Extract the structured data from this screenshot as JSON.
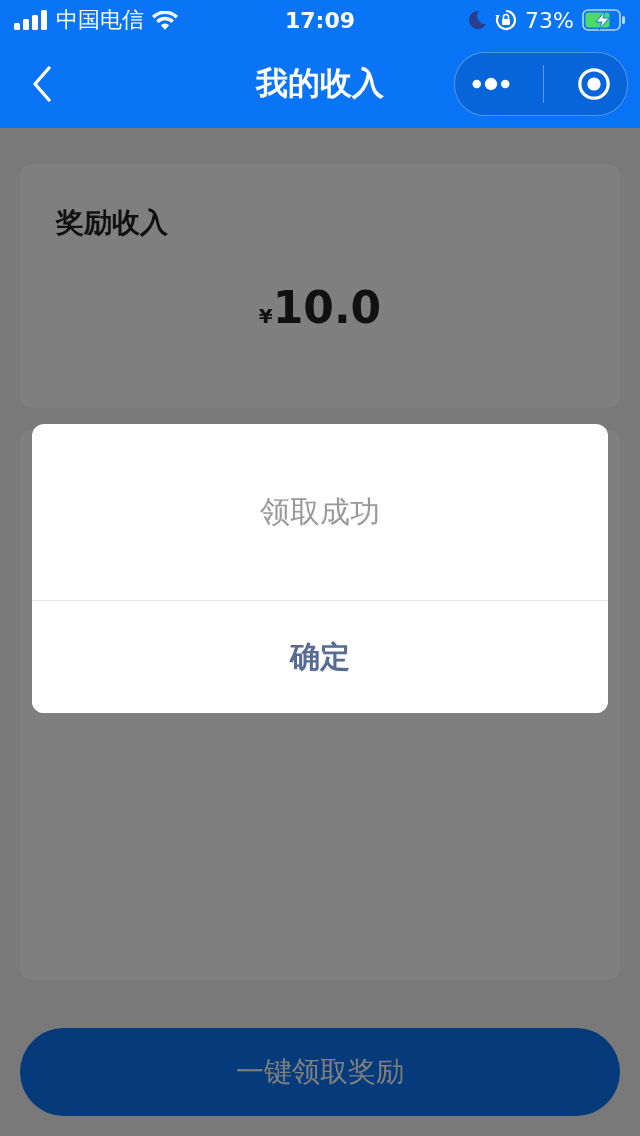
{
  "status_bar": {
    "carrier": "中国电信",
    "time": "17:09",
    "battery": "73%"
  },
  "nav_bar": {
    "title": "我的收入"
  },
  "income_card": {
    "title": "奖励收入",
    "currency": "¥",
    "amount": "10.0"
  },
  "dialog": {
    "message": "领取成功",
    "confirm_button": "确定"
  },
  "claim_button": {
    "label": "一键领取奖励"
  }
}
